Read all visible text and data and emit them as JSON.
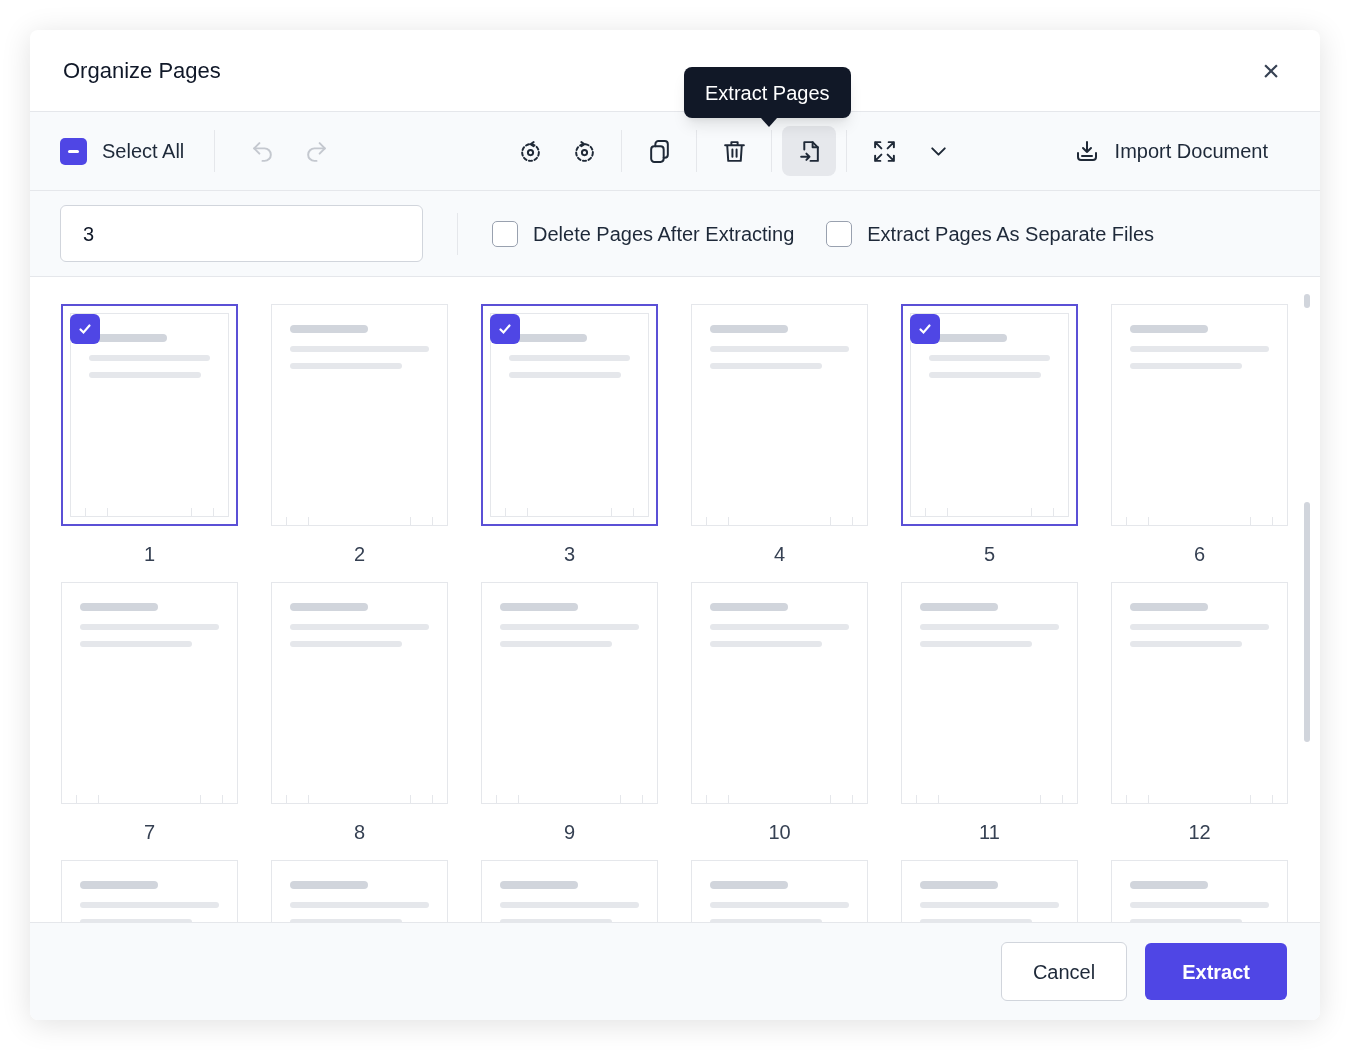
{
  "dialog": {
    "title": "Organize Pages",
    "close": "×"
  },
  "toolbar": {
    "select_all": {
      "label": "Select All",
      "indeterminate": true
    },
    "tools": [
      {
        "kind": "undo",
        "disabled": true,
        "active": false
      },
      {
        "kind": "redo",
        "disabled": true,
        "active": false
      },
      {
        "kind": "spacer"
      },
      {
        "kind": "rotate-left",
        "disabled": false,
        "active": false
      },
      {
        "kind": "rotate-right",
        "disabled": false,
        "active": false
      },
      {
        "kind": "divider"
      },
      {
        "kind": "copy",
        "disabled": false,
        "active": false
      },
      {
        "kind": "divider"
      },
      {
        "kind": "delete",
        "disabled": false,
        "active": false
      },
      {
        "kind": "divider"
      },
      {
        "kind": "extract",
        "disabled": false,
        "active": true
      },
      {
        "kind": "divider"
      },
      {
        "kind": "expand",
        "disabled": false,
        "active": false
      },
      {
        "kind": "chevron",
        "disabled": false,
        "active": false
      }
    ],
    "tooltip": "Extract Pages",
    "import": "Import Document"
  },
  "options": {
    "range": {
      "value": "3"
    },
    "checkboxes": [
      {
        "label": "Delete Pages After Extracting",
        "checked": false
      },
      {
        "label": "Extract Pages As Separate Files",
        "checked": false
      }
    ]
  },
  "pages": [
    {
      "label": "1",
      "selected": true
    },
    {
      "label": "2",
      "selected": false
    },
    {
      "label": "3",
      "selected": true
    },
    {
      "label": "4",
      "selected": false
    },
    {
      "label": "5",
      "selected": true
    },
    {
      "label": "6",
      "selected": false
    },
    {
      "label": "7",
      "selected": false
    },
    {
      "label": "8",
      "selected": false
    },
    {
      "label": "9",
      "selected": false
    },
    {
      "label": "10",
      "selected": false
    },
    {
      "label": "11",
      "selected": false
    },
    {
      "label": "12",
      "selected": false
    },
    {
      "selected": false
    },
    {
      "selected": false
    },
    {
      "selected": false
    },
    {
      "selected": false
    },
    {
      "selected": false
    },
    {
      "selected": false
    }
  ],
  "footer": {
    "buttons": [
      {
        "label": "Cancel",
        "kind": "secondary"
      },
      {
        "label": "Extract",
        "kind": "primary"
      }
    ]
  }
}
